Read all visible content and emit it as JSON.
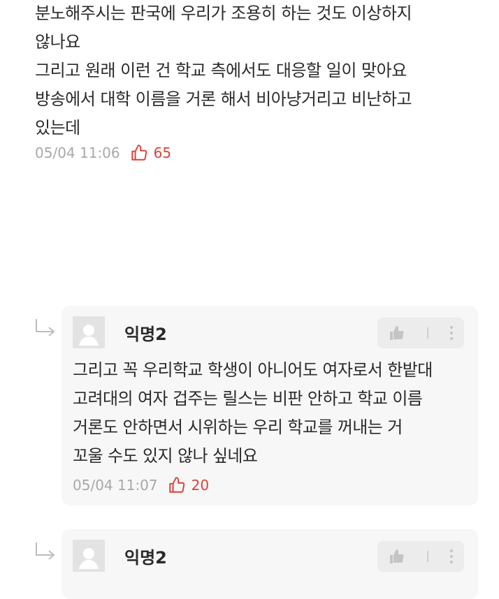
{
  "top_comment": {
    "text": "분노해주시는 판국에 우리가 조용히 하는 것도 이상하지\n않나요\n그리고 원래 이런 건 학교 측에서도 대응할 일이 맞아요\n방송에서 대학 이름을 거론 해서 비아냥거리고 비난하고\n있는데",
    "timestamp": "05/04 11:06",
    "likes": "65"
  },
  "replies": [
    {
      "author": "익명2",
      "text": "그리고 꼭 우리학교 학생이 아니어도 여자로서 한밭대\n고려대의 여자 겁주는 릴스는 비판 안하고 학교 이름\n거론도 안하면서 시위하는 우리 학교를 꺼내는 거\n꼬울 수도 있지 않나 싶네요",
      "timestamp": "05/04 11:07",
      "likes": "20"
    },
    {
      "author": "익명2"
    }
  ],
  "icons": {
    "reply_arrow": "reply-arrow-icon",
    "like": "thumbs-up-icon",
    "more": "more-vertical-icon",
    "avatar": "default-avatar-icon"
  },
  "colors": {
    "like_accent": "#d9423b",
    "meta_gray": "#a8a8a8",
    "card_bg": "#f7f7f7"
  }
}
